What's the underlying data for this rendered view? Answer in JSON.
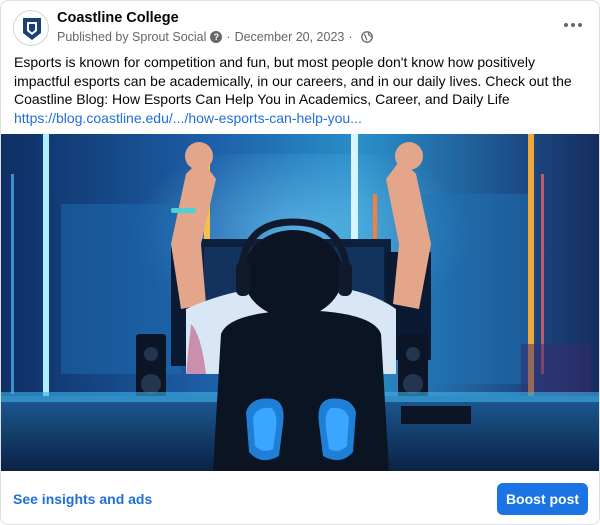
{
  "post": {
    "page_name": "Coastline College",
    "published_by": "Published by Sprout Social",
    "date": "December 20, 2023",
    "caption": "Esports is known for competition and fun, but most people don't know how positively impactful esports can be academically, in our careers, and in our daily lives. Check out the Coastline Blog: How Esports Can Help You in Academics, Career, and Daily Life",
    "link": "https://blog.coastline.edu/.../how-esports-can-help-you...",
    "icons": [
      "coastline-logo-icon",
      "help-icon",
      "globe-icon",
      "more-options-icon"
    ]
  },
  "footer": {
    "insights_label": "See insights and ads",
    "boost_label": "Boost post"
  },
  "colors": {
    "link_blue": "#216fdb",
    "button_blue": "#1b74e4",
    "logo_navy": "#1a3f7a",
    "meta_gray": "#65676b"
  }
}
